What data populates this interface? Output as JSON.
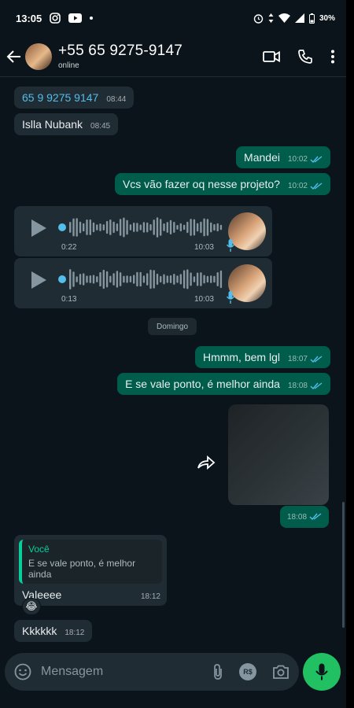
{
  "status_bar": {
    "time": "13:05",
    "battery": "30%"
  },
  "header": {
    "contact_name": "+55 65 9275-9147",
    "contact_status": "online"
  },
  "messages": [
    {
      "text": "65 9 9275 9147",
      "time": "08:44"
    },
    {
      "text": "Islla Nubank",
      "time": "08:45"
    },
    {
      "text": "Mandei",
      "time": "10:02"
    },
    {
      "text": "Vcs vão fazer oq nesse projeto?",
      "time": "10:02"
    },
    {
      "duration": "0:22",
      "time": "10:03"
    },
    {
      "duration": "0:13",
      "time": "10:03"
    },
    {
      "text": "Hmmm, bem lgl",
      "time": "18:07"
    },
    {
      "text": "E se vale ponto, é melhor ainda",
      "time": "18:08"
    },
    {
      "time": "18:08"
    },
    {
      "quote_author": "Você",
      "quote_text": "E se vale ponto, é melhor ainda",
      "text": "Valeeee",
      "time": "18:12",
      "reaction": "😂"
    },
    {
      "text": "Kkkkkk",
      "time": "18:12"
    }
  ],
  "date_separator": "Domingo",
  "composer": {
    "placeholder": "Mensagem",
    "pix_label": "R$"
  },
  "colors": {
    "background": "#0b141a",
    "incoming": "#202c33",
    "outgoing": "#005c4b",
    "accent": "#21c063",
    "link": "#53bdeb",
    "read_ticks": "#53bdeb"
  }
}
